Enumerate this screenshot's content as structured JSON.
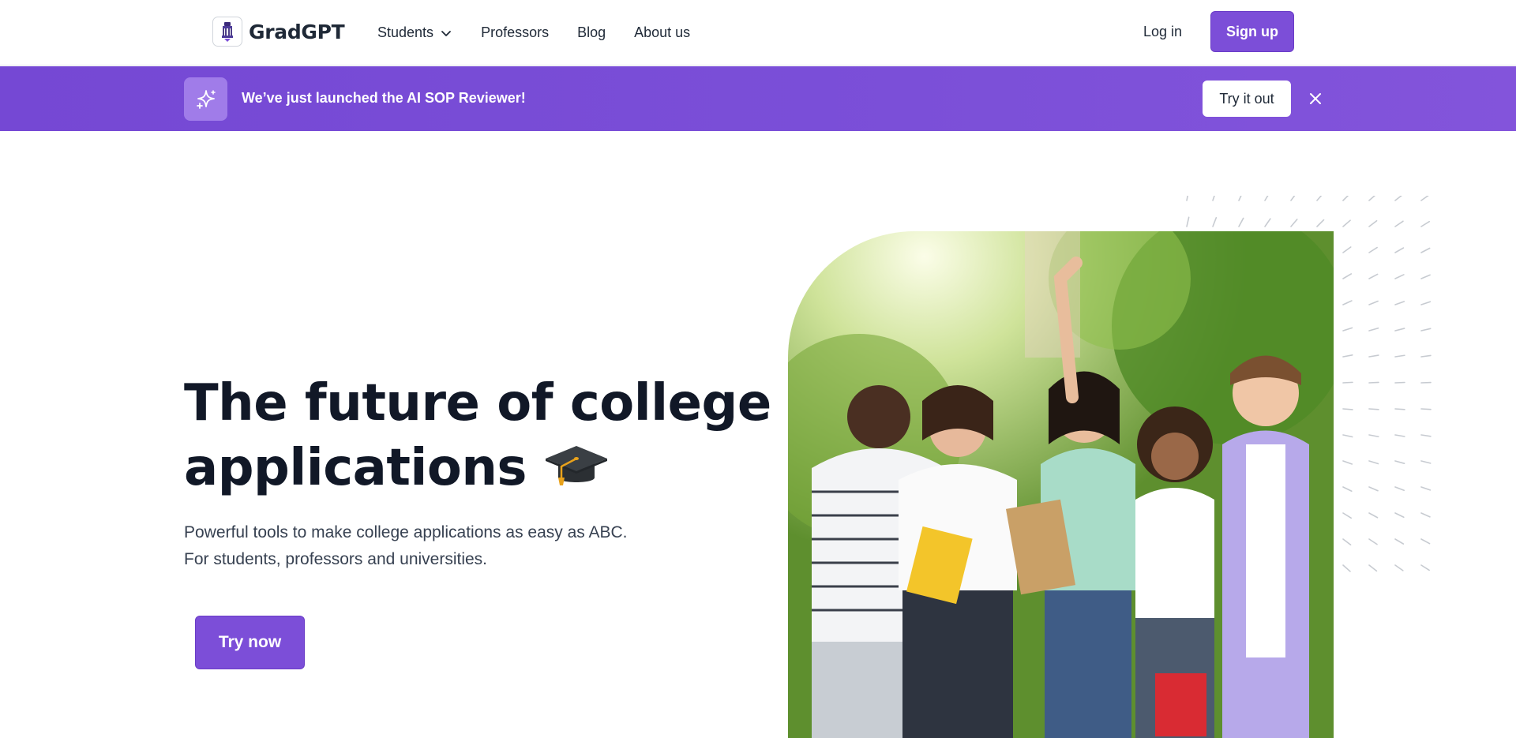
{
  "nav": {
    "logo_text": "GradGPT",
    "links": [
      {
        "label": "Students",
        "has_dropdown": true
      },
      {
        "label": "Professors"
      },
      {
        "label": "Blog"
      },
      {
        "label": "About us"
      }
    ],
    "login_label": "Log in",
    "signup_label": "Sign up"
  },
  "banner": {
    "message": "We’ve just launched the AI SOP Reviewer!",
    "cta_label": "Try it out",
    "icon": "sparkles-icon",
    "close_icon": "close-icon"
  },
  "hero": {
    "title_line1": "The future of college",
    "title_line2": "applications",
    "title_emoji": "graduation-cap-icon",
    "subtitle_line1": "Powerful tools to make college applications as easy as ABC.",
    "subtitle_line2": "For students, professors and universities.",
    "cta_label": "Try now",
    "image": "students-group-photo"
  },
  "colors": {
    "brand": "#7c4ed8",
    "banner": "#7548d4",
    "text_dark": "#111827",
    "text_body": "#374151"
  }
}
